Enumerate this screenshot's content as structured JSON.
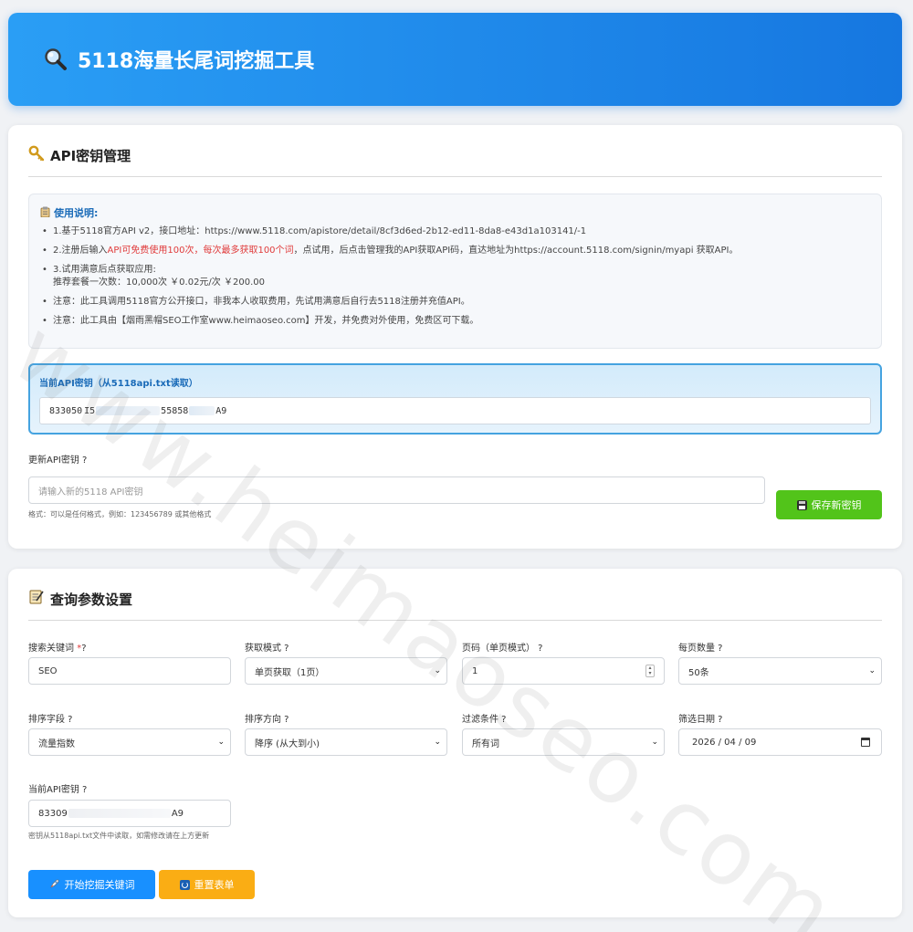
{
  "header": {
    "title": "5118海量长尾词挖掘工具",
    "icon": "magnifier-icon"
  },
  "api_section": {
    "title": "API密钥管理",
    "icon": "key-icon",
    "notice": {
      "title": "使用说明:",
      "item1": "1.基于5118官方API v2，接口地址：https://www.5118.com/apistore/detail/8cf3d6ed-2b12-ed11-8da8-e43d1a103141/-1",
      "item2_pre": "2.注册后输入",
      "item2_red": "API可免费使用100次，每次最多获取100个词",
      "item2_post": "，点试用，后点击管理我的API获取API码，直达地址为https://account.5118.com/signin/myapi 获取API。",
      "item3_line1": "3.试用满意后点获取应用:",
      "item3_line2": "推荐套餐一次数：10,000次 ￥0.02元/次 ￥200.00",
      "item4": "注意：此工具调用5118官方公开接口，非我本人收取费用，先试用满意后自行去5118注册并充值API。",
      "item5": "注意：此工具由【烟雨黑帽SEO工作室www.heimaoseo.com】开发，并免费对外使用，免费区可下载。"
    },
    "current_key": {
      "label": "当前API密钥（从5118api.txt读取）",
      "part1": "833050",
      "part2": "55858",
      "part3": "A9"
    },
    "update": {
      "label": "更新API密钥 ?",
      "placeholder": "请输入新的5118 API密钥",
      "hint": "格式：可以是任何格式，例如：123456789 或其他格式",
      "save_label": "保存新密钥"
    }
  },
  "query_section": {
    "title": "查询参数设置",
    "icon": "memo-icon",
    "keyword": {
      "label": "搜索关键词",
      "required": "*",
      "help": "?",
      "value": "SEO"
    },
    "mode": {
      "label": "获取模式 ?",
      "value": "单页获取（1页）"
    },
    "page": {
      "label": "页码（单页模式） ?",
      "value": "1"
    },
    "page_size": {
      "label": "每页数量 ?",
      "value": "50条"
    },
    "sort_field": {
      "label": "排序字段 ?",
      "value": "流量指数"
    },
    "sort_dir": {
      "label": "排序方向 ?",
      "value": "降序 (从大到小)"
    },
    "filter": {
      "label": "过滤条件 ?",
      "value": "所有词"
    },
    "date": {
      "label": "筛选日期 ?",
      "value": "2026 / 04 / 09"
    },
    "api_key": {
      "label": "当前API密钥 ?",
      "part1": "83309",
      "part2": "A9",
      "hint": "密钥从5118api.txt文件中读取，如需修改请在上方更新"
    },
    "start_label": "开始挖掘关键词",
    "reset_label": "重置表单"
  },
  "watermark": "www.heimaoseo.com"
}
